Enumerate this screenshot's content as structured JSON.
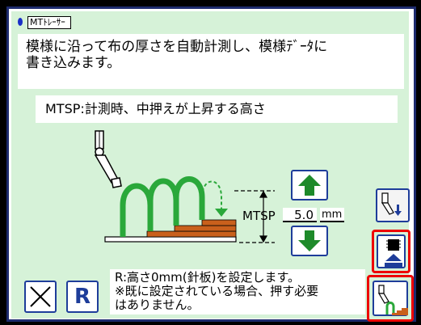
{
  "title": "MTﾄﾚｰｻｰ",
  "description": "模様に沿って布の厚さを自動計測し、模様ﾃﾞｰﾀに\n書き込みます。",
  "mtsp_description": "MTSP:計測時、中押えが上昇する高さ",
  "mtsp": {
    "label": "MTSP",
    "value": "5.0",
    "unit": "mm"
  },
  "r_description": "R:高さ0mm(針板)を設定します。\n※既に設定されている場合、押す必要\nはありません。",
  "buttons": {
    "reset_label": "R"
  },
  "icons": {
    "up": "up-arrow-icon",
    "down": "down-arrow-icon",
    "cancel": "close-icon",
    "write": "write-data-icon",
    "origin": "set-origin-icon",
    "trace": "trace-start-icon"
  },
  "colors": {
    "panel": "#d6f2d8",
    "arrow": "#1e8a2a",
    "frame": "#1d2b6e",
    "highlight": "#e00000",
    "stitch": "#2aa83a",
    "fabric": "#c9601c"
  }
}
